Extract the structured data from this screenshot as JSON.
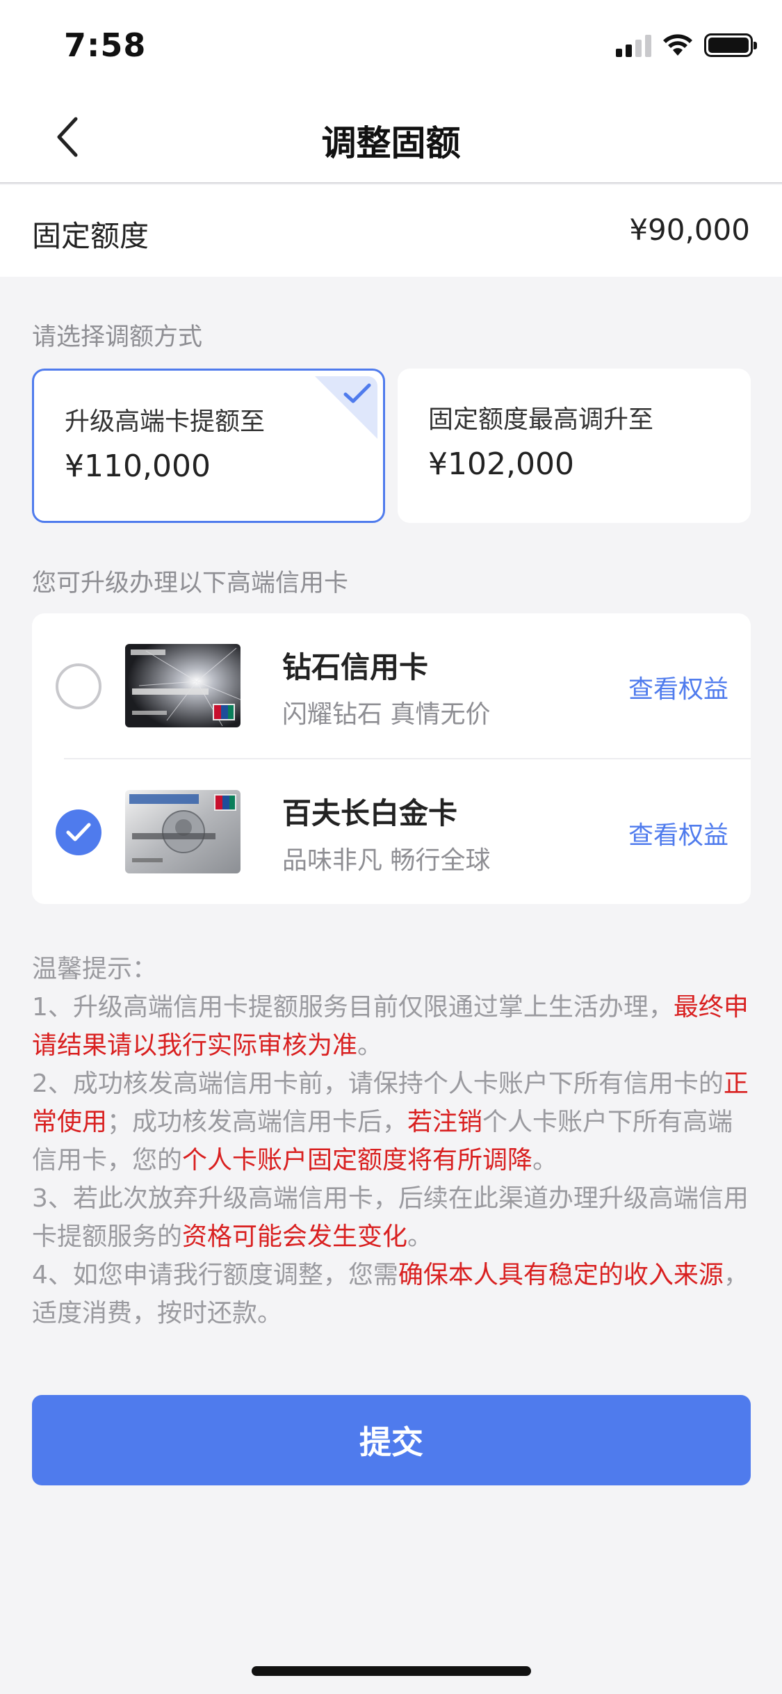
{
  "status_bar": {
    "time": "7:58"
  },
  "nav": {
    "title": "调整固额"
  },
  "fixed_limit": {
    "label": "固定额度",
    "value": "¥90,000"
  },
  "adjust_section": {
    "title": "请选择调额方式"
  },
  "options": [
    {
      "label": "升级高端卡提额至",
      "value": "¥110,000",
      "selected": true
    },
    {
      "label": "固定额度最高调升至",
      "value": "¥102,000",
      "selected": false
    }
  ],
  "cards_section": {
    "title": "您可升级办理以下高端信用卡"
  },
  "cards": [
    {
      "name": "钻石信用卡",
      "slogan": "闪耀钻石 真情无价",
      "link": "查看权益",
      "selected": false
    },
    {
      "name": "百夫长白金卡",
      "slogan": "品味非凡 畅行全球",
      "link": "查看权益",
      "selected": true
    }
  ],
  "tips": {
    "title": "温馨提示：",
    "t1_a": "1、升级高端信用卡提额服务目前仅限通过掌上生活办理，",
    "t1_b": "最终申请结果请以我行实际审核为准",
    "t1_c": "。",
    "t2_a": "2、成功核发高端信用卡前，请保持个人卡账户下所有信用卡的",
    "t2_b": "正常使用",
    "t2_c": "；成功核发高端信用卡后，",
    "t2_d": "若注销",
    "t2_e": "个人卡账户下所有高端信用卡，您的",
    "t2_f": "个人卡账户固定额度将有所调降",
    "t2_g": "。",
    "t3_a": "3、若此次放弃升级高端信用卡，后续在此渠道办理升级高端信用卡提额服务的",
    "t3_b": "资格可能会发生变化",
    "t3_c": "。",
    "t4_a": "4、如您申请我行额度调整，您需",
    "t4_b": "确保本人具有稳定的收入来源",
    "t4_c": "，适度消费，按时还款。"
  },
  "submit": {
    "label": "提交"
  },
  "colors": {
    "accent": "#4f7bed",
    "warning": "#d92020",
    "muted": "#9a9a9f"
  }
}
